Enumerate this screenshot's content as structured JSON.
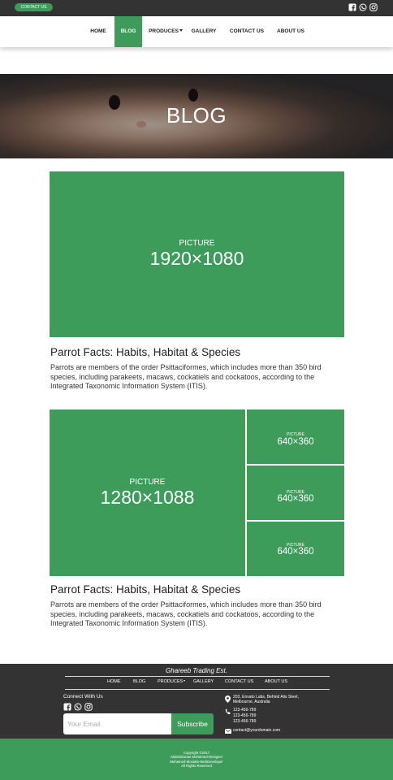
{
  "topbar": {
    "contact_label": "CONTACT US",
    "social_icons": [
      "facebook-icon",
      "whatsapp-icon",
      "instagram-icon"
    ]
  },
  "nav": {
    "items": [
      {
        "label": "HOME"
      },
      {
        "label": "BLOG",
        "active": true
      },
      {
        "label": "PRODUCES",
        "dropdown": true
      },
      {
        "label": "GALLERY"
      },
      {
        "label": "CONTACT US"
      },
      {
        "label": "ABOUT US"
      }
    ],
    "accent_color": "#3d9c5a"
  },
  "hero": {
    "title": "BLOG"
  },
  "posts": [
    {
      "image": {
        "label": "PICTURE",
        "size": "1920×1080"
      },
      "title": "Parrot Facts: Habits, Habitat & Species",
      "text": "Parrots are members of the order Psittaciformes, which includes more than 350 bird species, including parakeets, macaws, cockatiels and cockatoos, according to the Integrated Taxonomic Information System (ITIS)."
    },
    {
      "gallery": {
        "main": {
          "label": "PICTURE",
          "size": "1280×1088"
        },
        "side": [
          {
            "label": "PICTURE",
            "size": "640×360"
          },
          {
            "label": "PICTURE",
            "size": "640×360"
          },
          {
            "label": "PICTURE",
            "size": "640×360"
          }
        ]
      },
      "title": "Parrot Facts: Habits, Habitat & Species",
      "text": "Parrots are members of the order Psittaciformes, which includes more than 350 bird species, including parakeets, macaws, cockatiels and cockatoos, according to the Integrated Taxonomic Information System (ITIS)."
    }
  ],
  "footer": {
    "brand": "Ghareeb Trading Est.",
    "nav": [
      "HOME",
      "BLOG",
      "PRODUCES",
      "GALLERY",
      "CONTACT US",
      "ABOUT US"
    ],
    "connect_label": "Connect With Us",
    "social_icons": [
      "facebook-icon",
      "whatsapp-icon",
      "instagram-icon"
    ],
    "email_placeholder": "Your Email",
    "subscribe_label": "Subscribe",
    "address_line1": "203, Envato Labs, Behind Alis Steet,",
    "address_line2": "Melbourne, Australia",
    "phones": [
      "123-456-789",
      "123-456-789",
      "123-456-789"
    ],
    "email": "contact@yourdomain.com",
    "copyright": [
      "Copyright ©2017",
      "Abdalrahman Mohamed-Designer",
      "Mohamed Mostafa-WebDeveloper",
      "All Rights Reserved"
    ]
  }
}
